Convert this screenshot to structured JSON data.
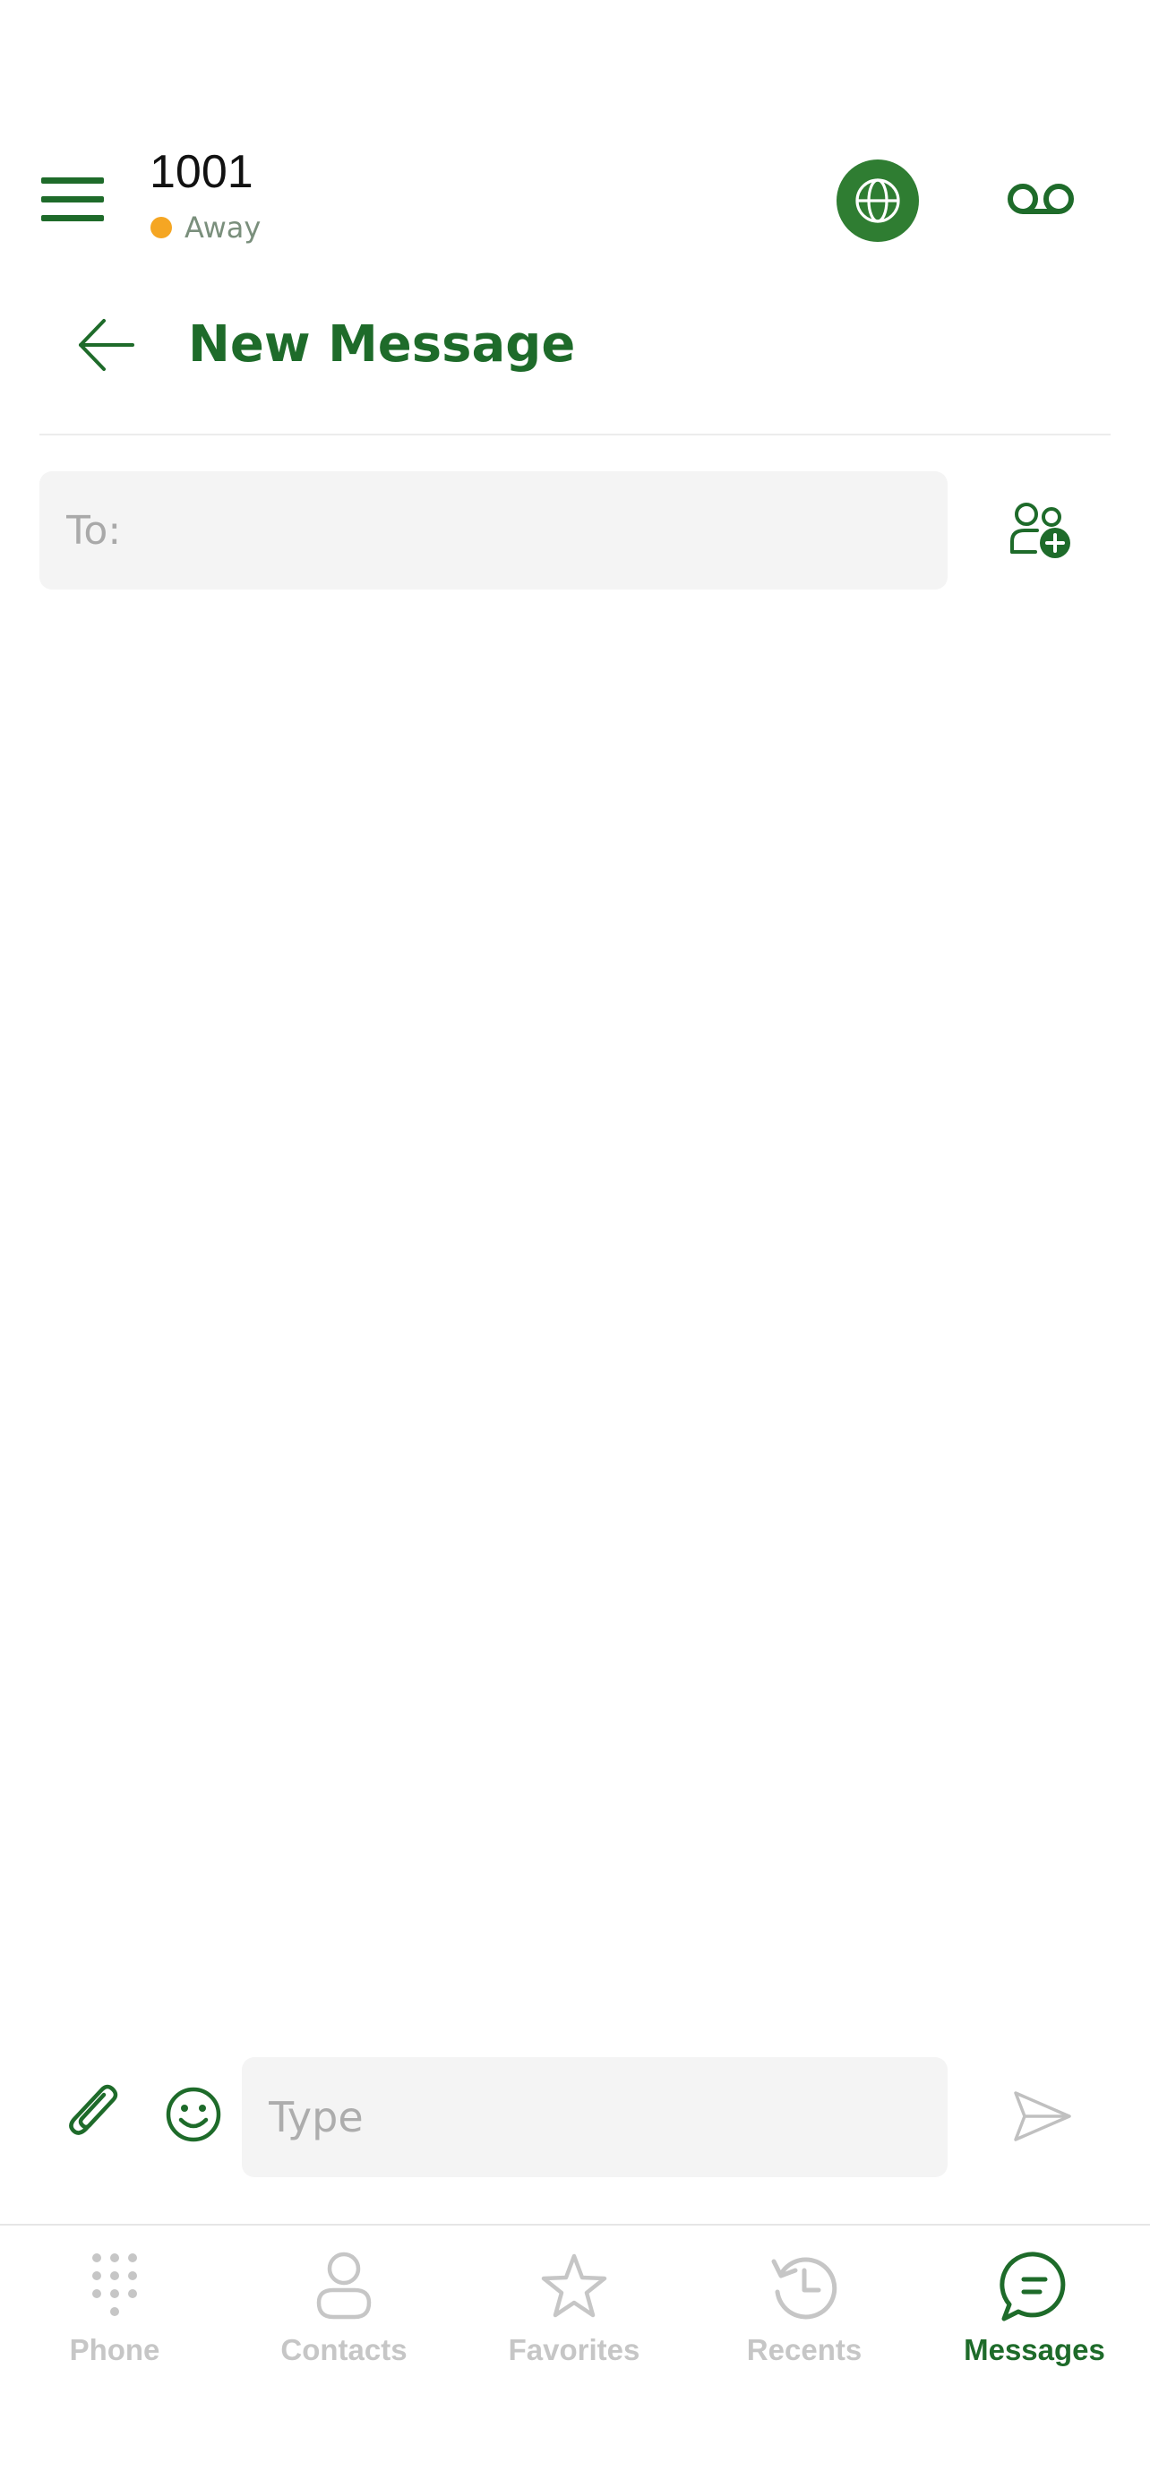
{
  "theme": {
    "accent": "#1e6b2a",
    "status_away": "#f5a623",
    "inactive": "#c6c6c6"
  },
  "header": {
    "extension": "1001",
    "status": "Away",
    "icons": [
      "menu-icon",
      "globe-icon",
      "voicemail-icon"
    ]
  },
  "page": {
    "title": "New Message",
    "back_icon": "arrow-left-icon"
  },
  "recipient": {
    "placeholder": "To:",
    "value": "",
    "add_icon": "add-contact-icon"
  },
  "composer": {
    "placeholder": "Type",
    "value": "",
    "icons": [
      "paperclip-icon",
      "emoji-icon",
      "send-icon"
    ]
  },
  "bottom_nav": {
    "active": "Messages",
    "items": [
      {
        "label": "Phone",
        "icon": "dialpad-icon"
      },
      {
        "label": "Contacts",
        "icon": "person-icon"
      },
      {
        "label": "Favorites",
        "icon": "star-icon"
      },
      {
        "label": "Recents",
        "icon": "history-icon"
      },
      {
        "label": "Messages",
        "icon": "chat-bubble-icon"
      }
    ]
  }
}
